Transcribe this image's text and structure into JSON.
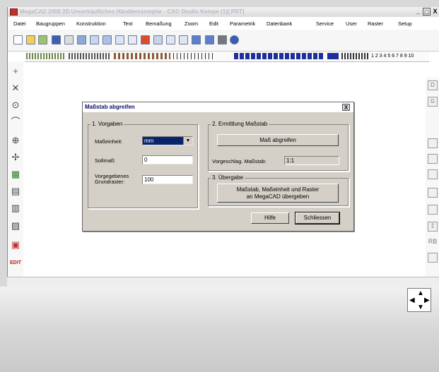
{
  "window": {
    "title": "MegaCAD 2008 2D  Unverkäufliches Händlerexemplar - CAD Studio Kempe (1)[.PRT]",
    "minimize": "_",
    "maximize": "□",
    "close": "X"
  },
  "menu": [
    "Datei",
    "Baugruppen",
    "Konstruktion",
    "Text",
    "Bemaßung",
    "Zoom",
    "Edit",
    "Parametrik",
    "Datenbank",
    "Service",
    "User",
    "Raster",
    "Setup"
  ],
  "layer_numbers": "1 2 3 4 5 6 7 8 9 10",
  "left_tools": [
    "+",
    "✕",
    "⊙",
    "⌒",
    "⊕",
    "✢",
    "▦",
    "▤",
    "▥",
    "▨",
    "▣"
  ],
  "left_edit_label": "EDIT",
  "right_tools": [
    "D",
    "G",
    "",
    "",
    "",
    "",
    "",
    "⁑",
    "RB",
    ""
  ],
  "dialog": {
    "title": "Maßstab abgreifen",
    "close": "X",
    "group1": {
      "title": "1. Vorgaben",
      "unit_label": "Maßeinheit:",
      "unit_value": "mm",
      "target_label": "Sollmaß:",
      "target_value": "0",
      "grid_label_line1": "Vorgegebenes",
      "grid_label_line2": "Grundraster:",
      "grid_value": "100"
    },
    "group2": {
      "title": "2. Ermittlung Maßstab",
      "measure_button": "Maß abgreifen",
      "suggestion_label": "Vorgeschlag. Maßstab:",
      "suggestion_value": "1:1"
    },
    "group3": {
      "title": "3. Übergabe",
      "transfer_line1": "Maßstab, Maßeinheit und Raster",
      "transfer_line2": "an MegaCAD übergeben"
    },
    "help_button": "Hilfe",
    "close_button": "Schliessen"
  },
  "colors": {
    "dialog_bg": "#d4d0c8",
    "accent_blue": "#1e2f9a",
    "selection_blue": "#0a246a"
  }
}
